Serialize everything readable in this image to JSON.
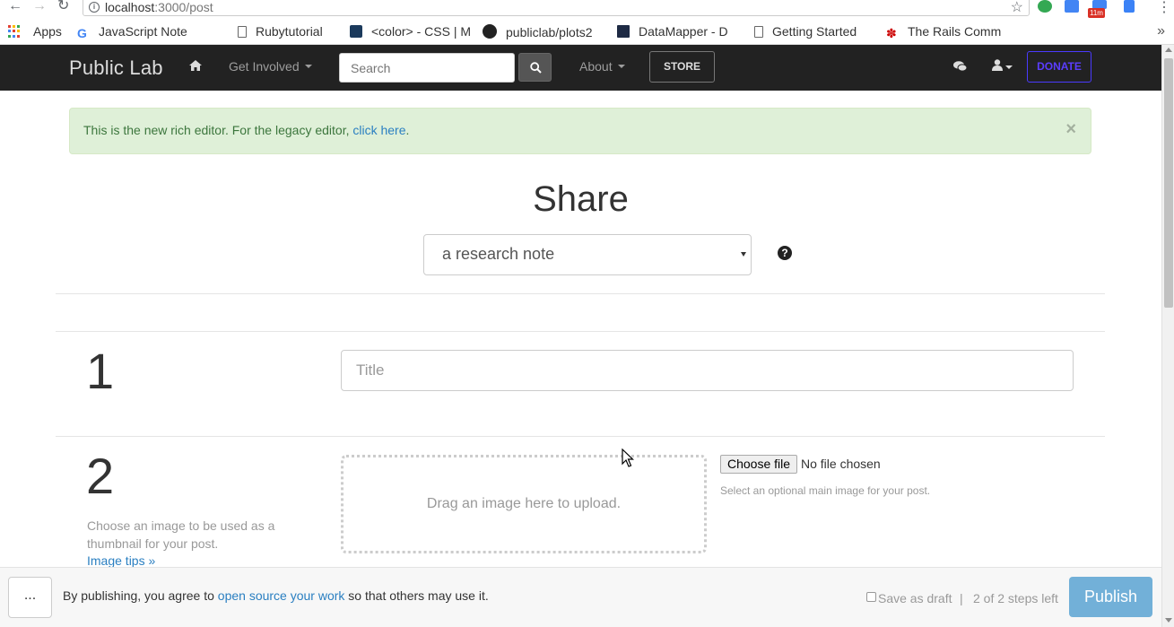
{
  "browser": {
    "url_host": "localhost",
    "url_path": ":3000/post",
    "extension_badge": "11m",
    "bookmarks": [
      {
        "label": "Apps",
        "icon": "apps-grid-icon"
      },
      {
        "label": "JavaScript Note",
        "icon": "google-icon"
      },
      {
        "label": "Rubytutorial",
        "icon": "document-icon"
      },
      {
        "label": "<color> - CSS | M",
        "icon": "mdn-icon"
      },
      {
        "label": "publiclab/plots2",
        "icon": "github-icon"
      },
      {
        "label": "DataMapper - D",
        "icon": "datamapper-icon"
      },
      {
        "label": "Getting Started",
        "icon": "document-icon"
      },
      {
        "label": "The Rails Comm",
        "icon": "rails-icon"
      }
    ]
  },
  "navbar": {
    "brand": "Public Lab",
    "get_involved": "Get Involved",
    "search_placeholder": "Search",
    "about": "About",
    "store": "STORE",
    "donate": "DONATE",
    "colors": {
      "bg": "#222222",
      "donate": "#5b3dff"
    }
  },
  "alert": {
    "text": "This is the new rich editor. For the legacy editor, ",
    "link": "click here",
    "suffix": ".",
    "close": "×"
  },
  "heading": {
    "title": "Share",
    "type_selected": "a research note",
    "help_icon": "?"
  },
  "step1": {
    "number": "1",
    "title_placeholder": "Title"
  },
  "step2": {
    "number": "2",
    "description": "Choose an image to be used as a thumbnail for your post.",
    "tips_link": "Image tips »",
    "dropzone_text": "Drag an image here to upload.",
    "choose_file": "Choose file",
    "no_file": "No file chosen",
    "help": "Select an optional main image for your post."
  },
  "footer": {
    "more": "...",
    "agree_prefix": "By publishing, you agree to ",
    "agree_link": "open source your work",
    "agree_suffix": " so that others may use it.",
    "draft_label": "Save as draft",
    "separator": "|",
    "steps_left": "2 of 2 steps left",
    "publish": "Publish"
  }
}
